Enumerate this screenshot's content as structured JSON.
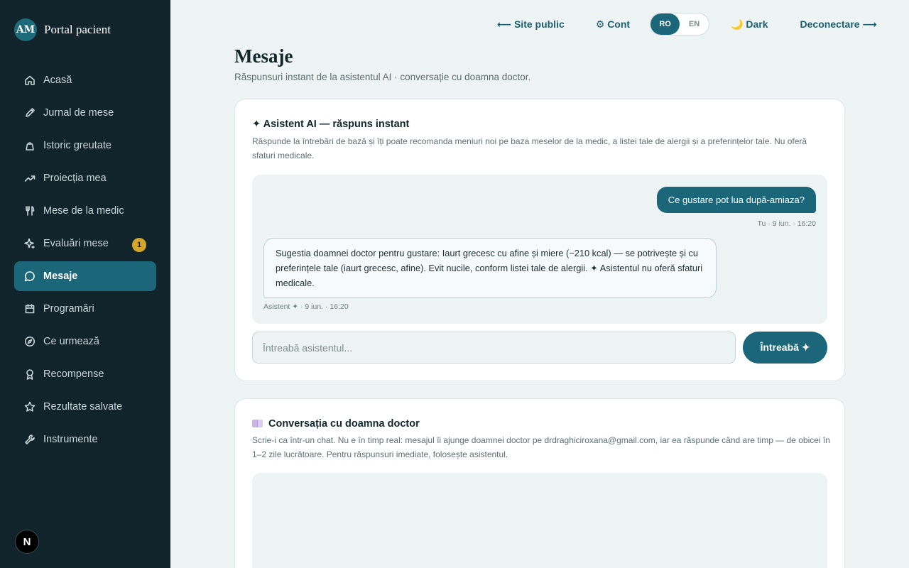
{
  "sidebar": {
    "avatar": "AM",
    "brand": "Portal pacient",
    "items": [
      {
        "label": "Acasă",
        "icon": "home-icon"
      },
      {
        "label": "Jurnal de mese",
        "icon": "pencil-icon"
      },
      {
        "label": "Istoric greutate",
        "icon": "scale-icon"
      },
      {
        "label": "Proiecția mea",
        "icon": "trend-up-icon"
      },
      {
        "label": "Mese de la medic",
        "icon": "fork-knife-icon"
      },
      {
        "label": "Evaluări mese",
        "icon": "sparkle-icon",
        "badge": "1"
      },
      {
        "label": "Mesaje",
        "icon": "chat-bubble-icon",
        "active": true
      },
      {
        "label": "Programări",
        "icon": "calendar-icon"
      },
      {
        "label": "Ce urmează",
        "icon": "compass-icon"
      },
      {
        "label": "Recompense",
        "icon": "award-icon"
      },
      {
        "label": "Rezultate salvate",
        "icon": "star-icon"
      },
      {
        "label": "Instrumente",
        "icon": "wrench-icon"
      }
    ],
    "footer_logo": "N"
  },
  "topbar": {
    "public_site": "⟵ Site public",
    "account": "⚙ Cont",
    "lang_ro": "RO",
    "lang_en": "EN",
    "dark": "🌙 Dark",
    "logout": "Deconectare ⟶"
  },
  "header": {
    "title": "Mesaje",
    "subtitle": "Răspunsuri instant de la asistentul AI · conversație cu doamna doctor."
  },
  "ai_card": {
    "title": "✦ Asistent AI — răspuns instant",
    "description": "Răspunde la întrebări de bază și îți poate recomanda meniuri noi pe baza meselor de la medic, a listei tale de alergii și a preferințelor tale. Nu oferă sfaturi medicale.",
    "messages": {
      "user_text": "Ce gustare pot lua după-amiaza?",
      "user_meta": "Tu · 9 iun. · 16:20",
      "assistant_text": "Sugestia doamnei doctor pentru gustare: Iaurt grecesc cu afine și miere (~210 kcal) — se potrivește și cu preferințele tale (iaurt grecesc, afine). Evit nucile, conform listei tale de alergii. ✦ Asistentul nu oferă sfaturi medicale.",
      "assistant_meta": "Asistent ✦ · 9 iun. · 16:20"
    },
    "input_placeholder": "Întreabă asistentul...",
    "ask_button": "Întreabă ✦"
  },
  "doctor_card": {
    "title": "Conversația cu doamna doctor",
    "description": "Scrie-i ca într-un chat. Nu e în timp real: mesajul îi ajunge doamnei doctor pe drdraghiciroxana@gmail.com, iar ea răspunde când are timp — de obicei în 1–2 zile lucrătoare. Pentru răspunsuri imediate, folosește asistentul."
  },
  "colors": {
    "sidebar_bg": "#11242b",
    "accent": "#1b6678",
    "badge": "#d4a72c",
    "page_bg": "#eef3f3"
  }
}
